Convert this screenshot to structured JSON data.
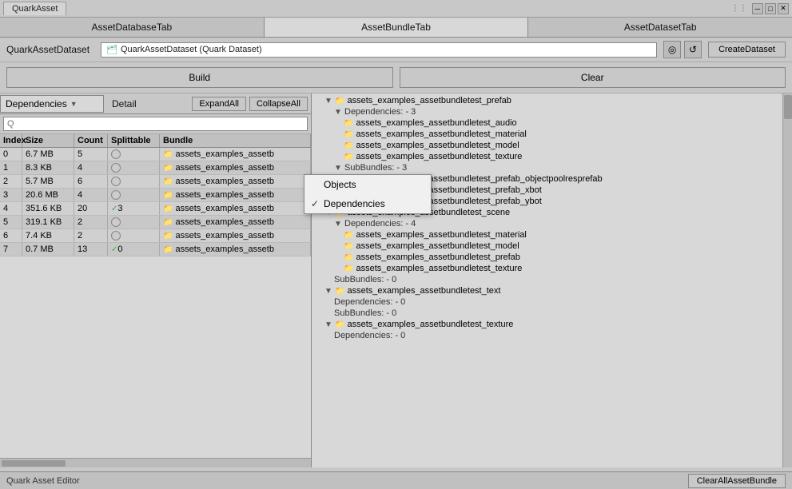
{
  "titleBar": {
    "tab": "QuarkAsset",
    "controls": [
      "⋮⋮",
      "─",
      "□",
      "✕"
    ]
  },
  "mainTabs": [
    {
      "label": "AssetDatabaseTab",
      "active": false
    },
    {
      "label": "AssetBundleTab",
      "active": true
    },
    {
      "label": "AssetDatasetTab",
      "active": false
    }
  ],
  "dataset": {
    "label": "QuarkAssetDataset",
    "icon": "🗂",
    "value": "QuarkAssetDataset (Quark Dataset)",
    "refreshLabel": "↺",
    "targetLabel": "◎",
    "createLabel": "CreateDataset"
  },
  "actions": {
    "buildLabel": "Build",
    "clearLabel": "Clear"
  },
  "subTabs": {
    "dropdown": "Dependencies",
    "detail": "Detail",
    "expandAll": "ExpandAll",
    "collapseAll": "CollapseAll"
  },
  "search": {
    "placeholder": "Q"
  },
  "tableHeaders": {
    "index": "Index",
    "size": "Size",
    "count": "Count",
    "splittable": "Splittable",
    "bundle": "Bundle"
  },
  "tableRows": [
    {
      "index": "0",
      "size": "6.7 MB",
      "count": "5",
      "splittable": "",
      "bundle": "assets_examples_assetb"
    },
    {
      "index": "1",
      "size": "8.3 KB",
      "count": "4",
      "splittable": "",
      "bundle": "assets_examples_assetb"
    },
    {
      "index": "2",
      "size": "5.7 MB",
      "count": "6",
      "splittable": "",
      "bundle": "assets_examples_assetb"
    },
    {
      "index": "3",
      "size": "20.6 MB",
      "count": "4",
      "splittable": "",
      "bundle": "assets_examples_assetb"
    },
    {
      "index": "4",
      "size": "351.6 KB",
      "count": "20",
      "splittable": "✓ 3",
      "bundle": "assets_examples_assetb",
      "hasCheck": true
    },
    {
      "index": "5",
      "size": "319.1 KB",
      "count": "2",
      "splittable": "",
      "bundle": "assets_examples_assetb"
    },
    {
      "index": "6",
      "size": "7.4 KB",
      "count": "2",
      "splittable": "",
      "bundle": "assets_examples_assetb"
    },
    {
      "index": "7",
      "size": "0.7 MB",
      "count": "13",
      "splittable": "✓ 0",
      "bundle": "assets_examples_assetb",
      "hasCheck": true
    }
  ],
  "rightPanel": {
    "topBundle": "assets_examples_assetbundletest_prefab",
    "treeItems": [
      {
        "indent": 2,
        "type": "label",
        "text": "Dependencies: - 3",
        "hasArrow": false
      },
      {
        "indent": 3,
        "type": "folder",
        "text": "assets_examples_assetbundletest_audio"
      },
      {
        "indent": 3,
        "type": "folder",
        "text": "assets_examples_assetbundletest_material"
      },
      {
        "indent": 3,
        "type": "folder",
        "text": "assets_examples_assetbundletest_model"
      },
      {
        "indent": 3,
        "type": "folder",
        "text": "assets_examples_assetbundletest_texture"
      },
      {
        "indent": 2,
        "type": "label",
        "text": "SubBundles: - 3",
        "hasArrow": true
      },
      {
        "indent": 3,
        "type": "folder",
        "text": "assets_examples_assetbundletest_prefab_objectpoolresprefab"
      },
      {
        "indent": 3,
        "type": "folder",
        "text": "assets_examples_assetbundletest_prefab_xbot"
      },
      {
        "indent": 3,
        "type": "folder",
        "text": "assets_examples_assetbundletest_prefab_ybot"
      },
      {
        "indent": 1,
        "type": "folder-arrow",
        "text": "assets_examples_assetbundletest_scene",
        "hasArrow": true
      },
      {
        "indent": 2,
        "type": "label",
        "text": "Dependencies: - 4",
        "hasArrow": true
      },
      {
        "indent": 3,
        "type": "folder",
        "text": "assets_examples_assetbundletest_material"
      },
      {
        "indent": 3,
        "type": "folder",
        "text": "assets_examples_assetbundletest_model"
      },
      {
        "indent": 3,
        "type": "folder",
        "text": "assets_examples_assetbundletest_prefab"
      },
      {
        "indent": 3,
        "type": "folder",
        "text": "assets_examples_assetbundletest_texture"
      },
      {
        "indent": 2,
        "type": "label",
        "text": "SubBundles: - 0"
      },
      {
        "indent": 1,
        "type": "folder-arrow",
        "text": "assets_examples_assetbundletest_text",
        "hasArrow": true
      },
      {
        "indent": 2,
        "type": "label",
        "text": "Dependencies: - 0"
      },
      {
        "indent": 2,
        "type": "label",
        "text": "SubBundles: - 0"
      },
      {
        "indent": 1,
        "type": "folder-arrow",
        "text": "assets_examples_assetbundletest_texture",
        "hasArrow": true
      },
      {
        "indent": 2,
        "type": "label",
        "text": "Dependencies: - 0"
      }
    ]
  },
  "dropdown": {
    "items": [
      {
        "label": "Objects",
        "checked": false
      },
      {
        "label": "Dependencies",
        "checked": true
      }
    ]
  },
  "statusBar": {
    "label": "Quark Asset Editor",
    "clearAllLabel": "ClearAllAssetBundle"
  }
}
